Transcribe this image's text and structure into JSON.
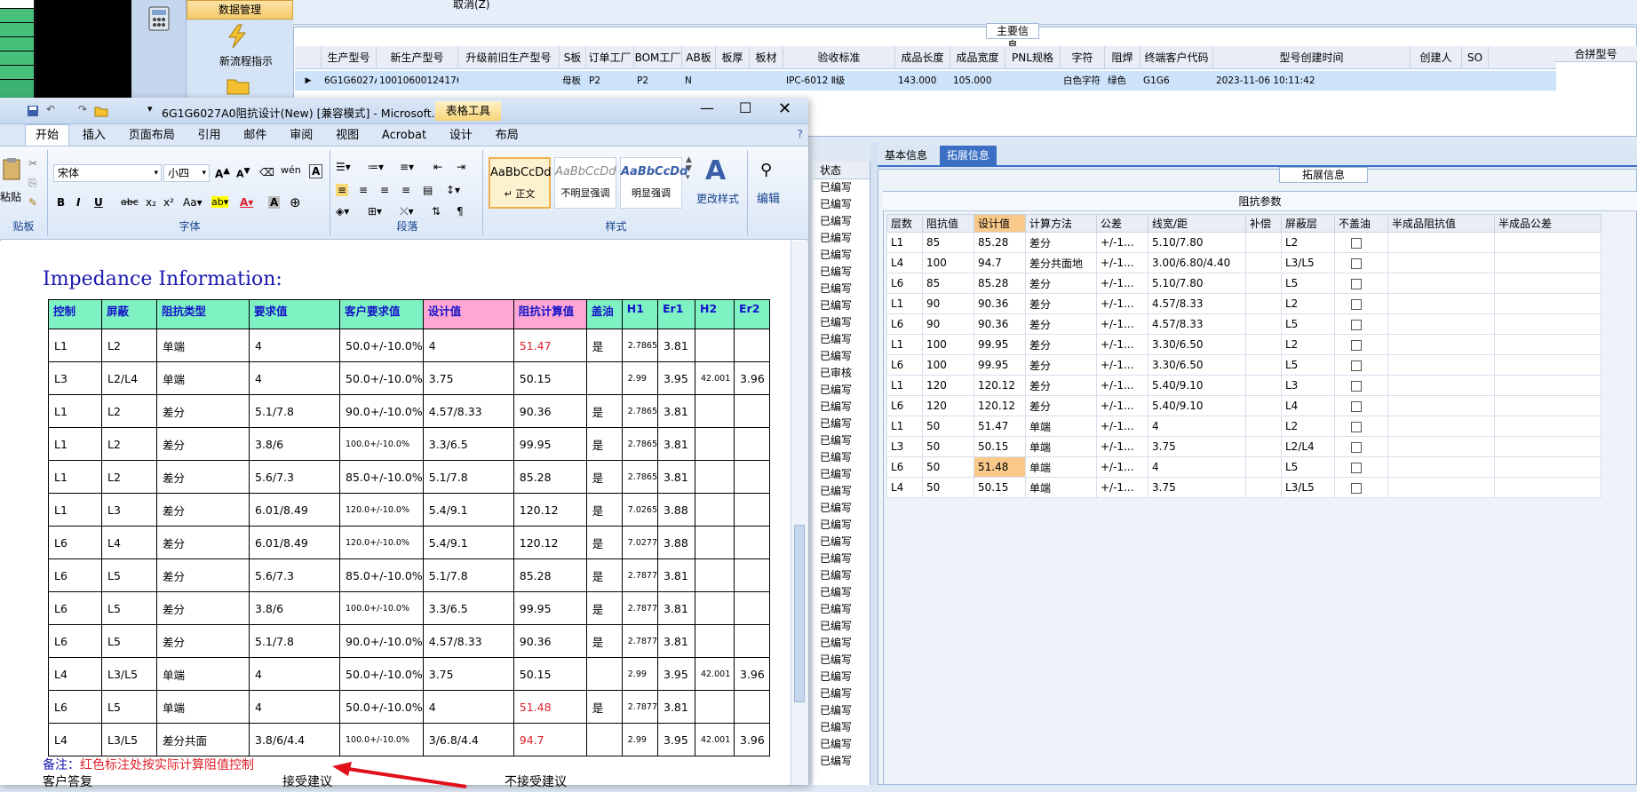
{
  "erp": {
    "nav": {
      "data_mgmt": "数据管理",
      "new_flow": "新流程指示"
    },
    "top_label": "取消(Z)",
    "main_group_title": "主要信息",
    "columns": [
      "生产型号",
      "新生产型号",
      "升级前旧生产型号",
      "S板",
      "订单工厂",
      "BOM工厂",
      "AB板",
      "板厚",
      "板材",
      "验收标准",
      "成品长度",
      "成品宽度",
      "PNL规格",
      "字符",
      "阻焊",
      "终端客户代码",
      "型号创建时间",
      "创建人",
      "SO"
    ],
    "row": [
      "6G1G6027A0",
      "10010600124176",
      "",
      "母板",
      "P2",
      "P2",
      "N",
      "",
      "",
      "IPC-6012 Ⅱ级",
      "143.000",
      "105.000",
      "",
      "白色字符",
      "绿色",
      "G1G6",
      "2023-11-06 10:11:42",
      "",
      ""
    ],
    "merge_label": "合拼型号",
    "status_header": "状态",
    "status_items": [
      "已编写",
      "已编写",
      "已编写",
      "已编写",
      "已编写",
      "已编写",
      "已编写",
      "已编写",
      "已编写",
      "已编写",
      "已编写",
      "已审核",
      "已编写",
      "已编写",
      "已编写",
      "已编写",
      "已编写",
      "已编写",
      "已编写",
      "已编写",
      "已编写",
      "已编写",
      "已编写",
      "已编写",
      "已编写",
      "已编写",
      "已编写",
      "已编写",
      "已编写",
      "已编写",
      "已编写",
      "已编写",
      "已编写",
      "已编写",
      "已编写"
    ],
    "tabs": [
      "基本信息",
      "拓展信息"
    ],
    "ext_title": "拓展信息",
    "imp_caption": "阻抗参数",
    "imp_headers": [
      "层数",
      "阻抗值",
      "设计值",
      "计算方法",
      "公差",
      "线宽/距",
      "补偿",
      "屏蔽层",
      "不盖油",
      "半成品阻抗值",
      "半成品公差"
    ],
    "imp_rows": [
      [
        "L1",
        "85",
        "85.28",
        "差分",
        "+/-1...",
        "5.10/7.80",
        "",
        "L2"
      ],
      [
        "L4",
        "100",
        "94.7",
        "差分共面地",
        "+/-1...",
        "3.00/6.80/4.40",
        "",
        "L3/L5"
      ],
      [
        "L6",
        "85",
        "85.28",
        "差分",
        "+/-1...",
        "5.10/7.80",
        "",
        "L5"
      ],
      [
        "L1",
        "90",
        "90.36",
        "差分",
        "+/-1...",
        "4.57/8.33",
        "",
        "L2"
      ],
      [
        "L6",
        "90",
        "90.36",
        "差分",
        "+/-1...",
        "4.57/8.33",
        "",
        "L5"
      ],
      [
        "L1",
        "100",
        "99.95",
        "差分",
        "+/-1...",
        "3.30/6.50",
        "",
        "L2"
      ],
      [
        "L6",
        "100",
        "99.95",
        "差分",
        "+/-1...",
        "3.30/6.50",
        "",
        "L5"
      ],
      [
        "L1",
        "120",
        "120.12",
        "差分",
        "+/-1...",
        "5.40/9.10",
        "",
        "L3"
      ],
      [
        "L6",
        "120",
        "120.12",
        "差分",
        "+/-1...",
        "5.40/9.10",
        "",
        "L4"
      ],
      [
        "L1",
        "50",
        "51.47",
        "单端",
        "+/-1...",
        "4",
        "",
        "L2"
      ],
      [
        "L3",
        "50",
        "50.15",
        "单端",
        "+/-1...",
        "3.75",
        "",
        "L2/L4"
      ],
      [
        "L6",
        "50",
        "51.48",
        "单端",
        "+/-1...",
        "4",
        "",
        "L5"
      ],
      [
        "L4",
        "50",
        "50.15",
        "单端",
        "+/-1...",
        "3.75",
        "",
        "L3/L5"
      ]
    ]
  },
  "word": {
    "title": "6G1G6027A0阻抗设计(New) [兼容模式] - Microsoft...",
    "table_tools": "表格工具",
    "tabs": [
      "开始",
      "插入",
      "页面布局",
      "引用",
      "邮件",
      "审阅",
      "视图",
      "Acrobat",
      "设计",
      "布局"
    ],
    "font_name": "宋体",
    "font_size": "小四",
    "group_font": "字体",
    "group_para": "段落",
    "group_style": "样式",
    "group_clip": "贴板",
    "paste": "粘贴",
    "styles": [
      {
        "sample": "AaBbCcDd",
        "name": "↵ 正文"
      },
      {
        "sample": "AaBbCcDd",
        "name": "不明显强调"
      },
      {
        "sample": "AaBbCcDd",
        "name": "明显强调"
      }
    ],
    "change_style": "更改样式",
    "edit": "编辑",
    "heading": "Impedance Information:",
    "doc_headers": [
      "控制",
      "屏蔽",
      "阻抗类型",
      "要求值",
      "客户要求值",
      "设计值",
      "阻抗计算值",
      "盖油",
      "H1",
      "Er1",
      "H2",
      "Er2"
    ],
    "doc_rows": [
      [
        "L1",
        "L2",
        "单端",
        "4",
        "50.0+/-10.0%",
        "4",
        "51.47",
        "是",
        "2.7865",
        "3.81",
        "",
        ""
      ],
      [
        "L3",
        "L2/L4",
        "单端",
        "4",
        "50.0+/-10.0%",
        "3.75",
        "50.15",
        "",
        "2.99",
        "3.95",
        "42.001",
        "3.96"
      ],
      [
        "L1",
        "L2",
        "差分",
        "5.1/7.8",
        "90.0+/-10.0%",
        "4.57/8.33",
        "90.36",
        "是",
        "2.7865",
        "3.81",
        "",
        ""
      ],
      [
        "L1",
        "L2",
        "差分",
        "3.8/6",
        "100.0+/-10.0%",
        "3.3/6.5",
        "99.95",
        "是",
        "2.7865",
        "3.81",
        "",
        ""
      ],
      [
        "L1",
        "L2",
        "差分",
        "5.6/7.3",
        "85.0+/-10.0%",
        "5.1/7.8",
        "85.28",
        "是",
        "2.7865",
        "3.81",
        "",
        ""
      ],
      [
        "L1",
        "L3",
        "差分",
        "6.01/8.49",
        "120.0+/-10.0%",
        "5.4/9.1",
        "120.12",
        "是",
        "7.0265",
        "3.88",
        "",
        ""
      ],
      [
        "L6",
        "L4",
        "差分",
        "6.01/8.49",
        "120.0+/-10.0%",
        "5.4/9.1",
        "120.12",
        "是",
        "7.0277",
        "3.88",
        "",
        ""
      ],
      [
        "L6",
        "L5",
        "差分",
        "5.6/7.3",
        "85.0+/-10.0%",
        "5.1/7.8",
        "85.28",
        "是",
        "2.7877",
        "3.81",
        "",
        ""
      ],
      [
        "L6",
        "L5",
        "差分",
        "3.8/6",
        "100.0+/-10.0%",
        "3.3/6.5",
        "99.95",
        "是",
        "2.7877",
        "3.81",
        "",
        ""
      ],
      [
        "L6",
        "L5",
        "差分",
        "5.1/7.8",
        "90.0+/-10.0%",
        "4.57/8.33",
        "90.36",
        "是",
        "2.7877",
        "3.81",
        "",
        ""
      ],
      [
        "L4",
        "L3/L5",
        "单端",
        "4",
        "50.0+/-10.0%",
        "3.75",
        "50.15",
        "",
        "2.99",
        "3.95",
        "42.001",
        "3.96"
      ],
      [
        "L6",
        "L5",
        "单端",
        "4",
        "50.0+/-10.0%",
        "4",
        "51.48",
        "是",
        "2.7877",
        "3.81",
        "",
        ""
      ],
      [
        "L4",
        "L3/L5",
        "差分共面",
        "3.8/6/4.4",
        "100.0+/-10.0%",
        "3/6.8/4.4",
        "94.7",
        "",
        "2.99",
        "3.95",
        "42.001",
        "3.96"
      ]
    ],
    "red_calc_rows": [
      0,
      11,
      12
    ],
    "note_label": "备注：",
    "note_text": "红色标注处按实际计算阻值控制",
    "bottom_text": [
      "客户答复",
      "接受建议",
      "不接受建议"
    ]
  }
}
